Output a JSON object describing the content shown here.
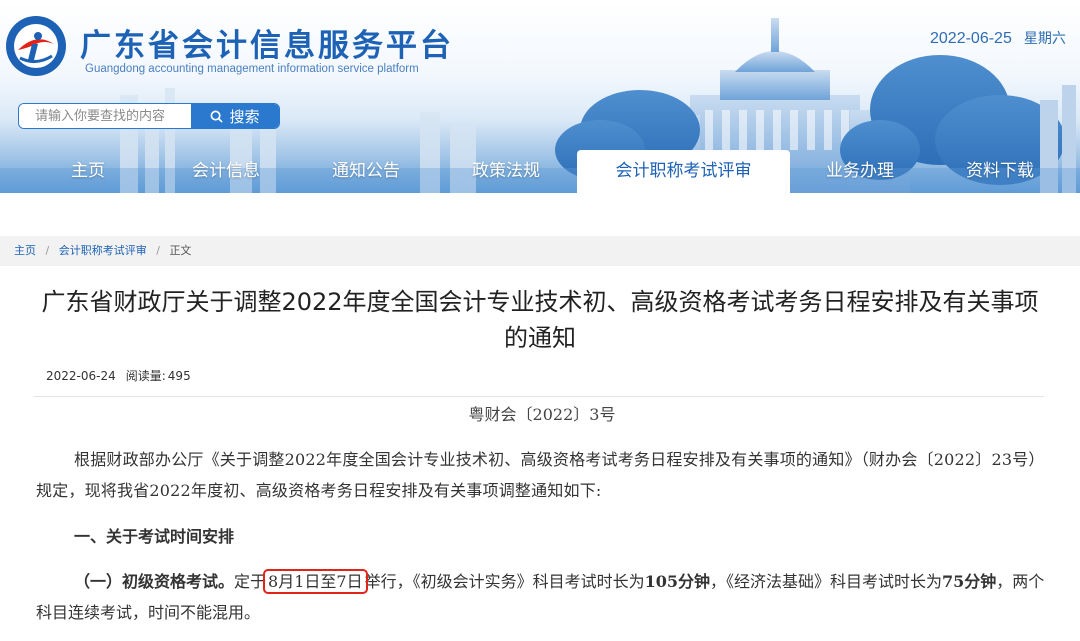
{
  "header": {
    "site_title": "广东省会计信息服务平台",
    "site_subtitle": "Guangdong accounting management information service platform",
    "date": "2022-06-25",
    "weekday": "星期六",
    "search": {
      "placeholder": "请输入你要查找的内容",
      "button_label": "搜索"
    }
  },
  "nav": {
    "items": [
      {
        "label": "主页"
      },
      {
        "label": "会计信息"
      },
      {
        "label": "通知公告"
      },
      {
        "label": "政策法规"
      },
      {
        "label": "会计职称考试评审",
        "active": true
      },
      {
        "label": "业务办理"
      },
      {
        "label": "资料下载"
      }
    ]
  },
  "breadcrumb": {
    "home": "主页",
    "section": "会计职称考试评审",
    "current": "正文",
    "separator": "/"
  },
  "article": {
    "title": "广东省财政厅关于调整2022年度全国会计专业技术初、高级资格考试考务日程安排及有关事项的通知",
    "date": "2022-06-24",
    "views_label": "阅读量:",
    "views": "495",
    "doc_no": "粤财会〔2022〕3号",
    "para1": "根据财政部办公厅《关于调整2022年度全国会计专业技术初、高级资格考试考务日程安排及有关事项的通知》（财办会〔2022〕23号）规定，现将我省2022年度初、高级资格考务日程安排及有关事项调整通知如下:",
    "heading1": "一、关于考试时间安排",
    "para2": {
      "lead": "（一）初级资格考试。",
      "t1": "定于",
      "highlight": "8月1日至7日",
      "t2": "举行，《初级会计实务》科目考试时长为",
      "b1": "105分钟",
      "t3": "，《经济法基础》科目考试时长为",
      "b2": "75分钟",
      "t4": "，两个科目连续考试，时间不能混用。"
    }
  },
  "colors": {
    "brand_blue": "#1d62b5",
    "nav_blue": "#5f9cd6",
    "highlight_red": "#e2231a"
  }
}
